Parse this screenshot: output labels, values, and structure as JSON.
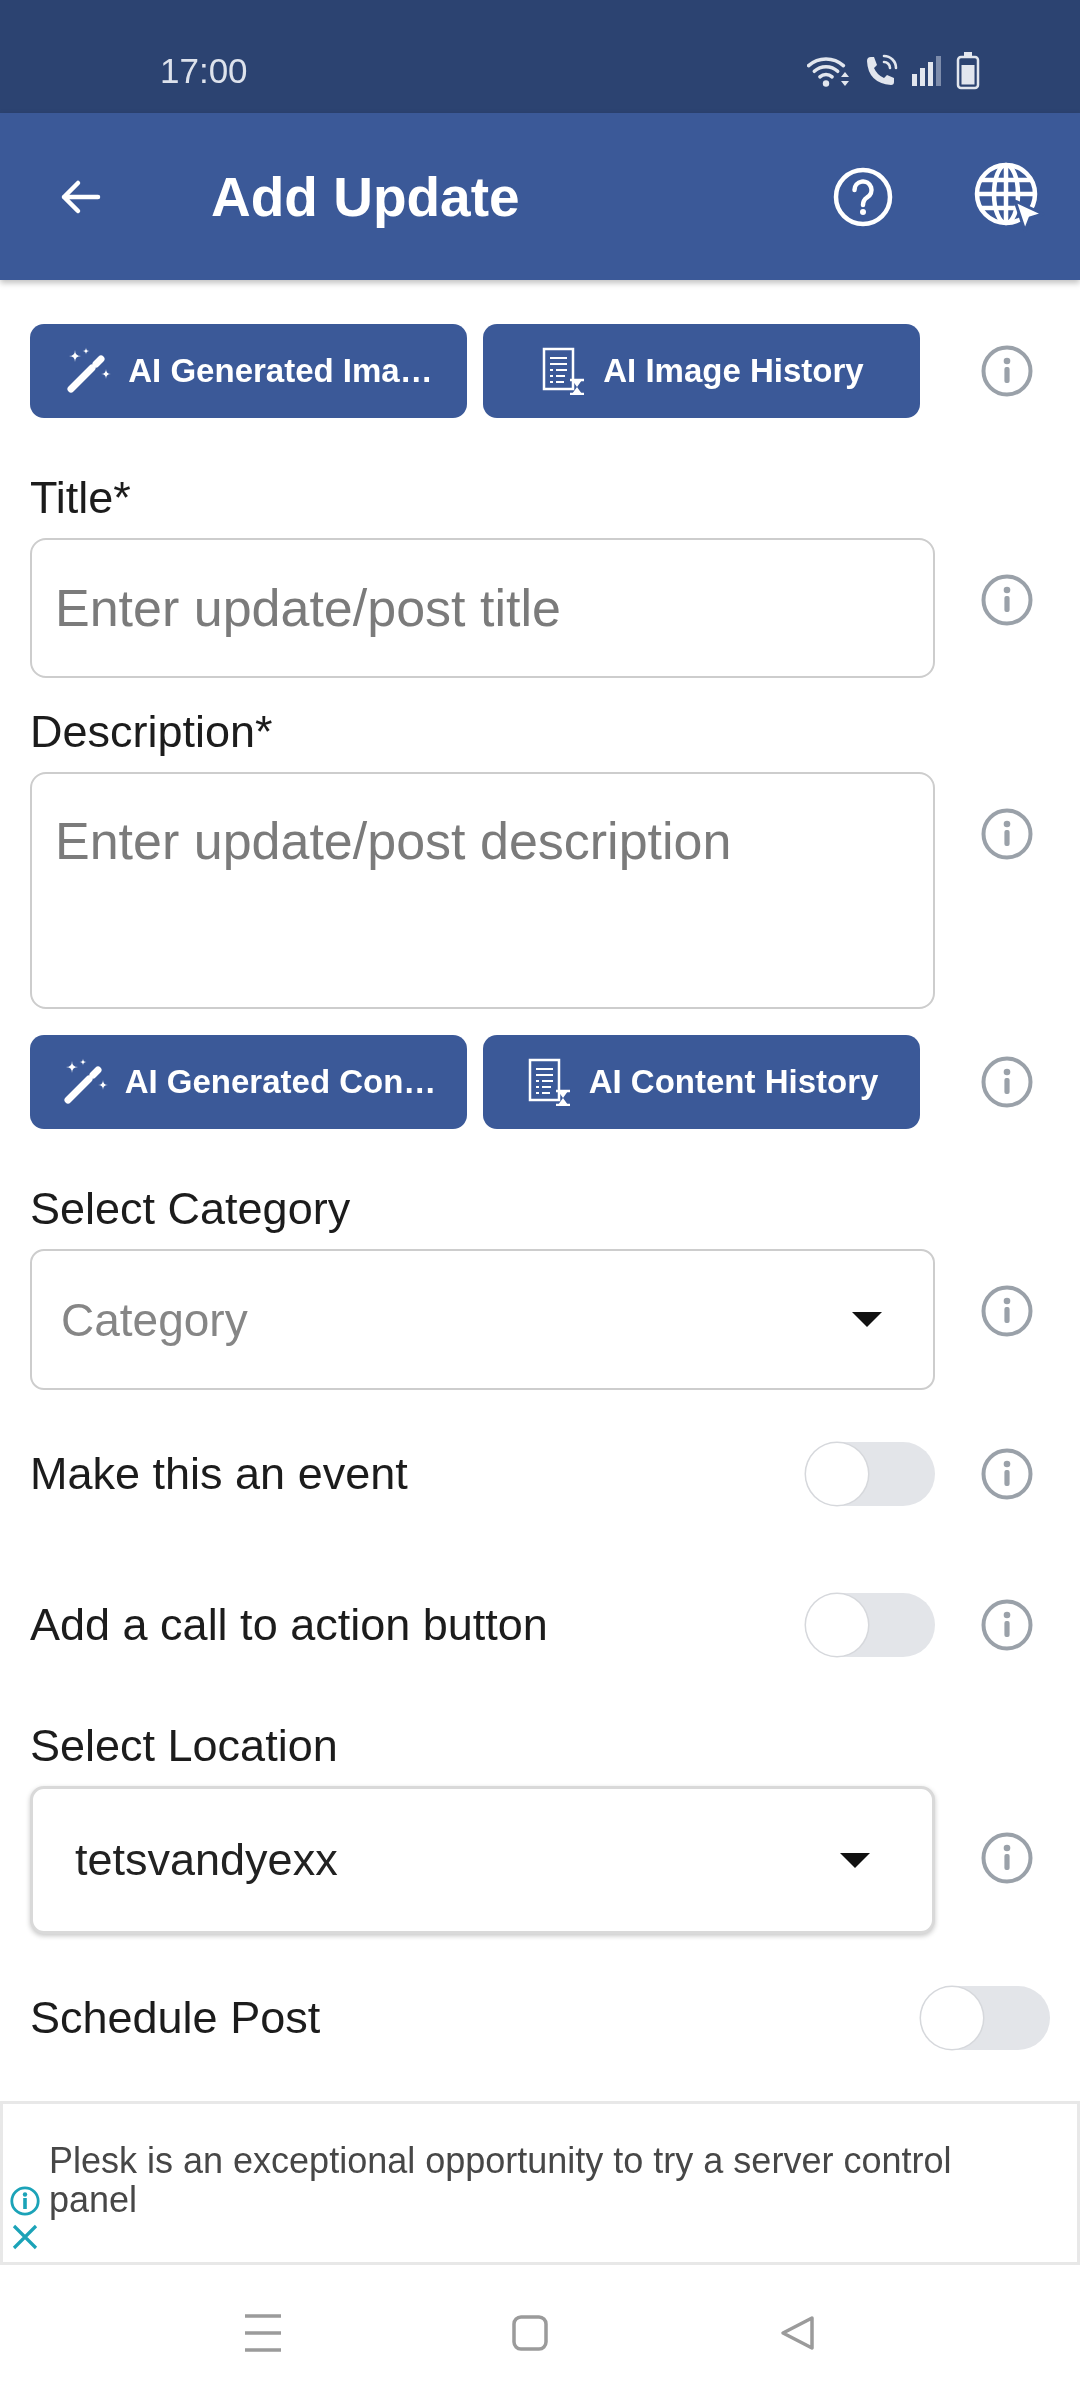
{
  "status_bar": {
    "time": "17:00"
  },
  "app_bar": {
    "title": "Add Update"
  },
  "form": [
    {
      "kind": "button_row",
      "buttons": [
        {
          "kind": "generate",
          "label": "AI Generated Ima…"
        },
        {
          "kind": "history",
          "label": "AI Image History"
        }
      ],
      "info_button": true
    },
    {
      "kind": "text",
      "label": "Title*",
      "placeholder": "Enter update/post title",
      "info_button": true
    },
    {
      "kind": "textarea",
      "label": "Description*",
      "placeholder": "Enter update/post description",
      "info_button": true
    },
    {
      "kind": "button_row",
      "buttons": [
        {
          "kind": "generate",
          "label": "AI Generated Con…"
        },
        {
          "kind": "history",
          "label": "AI Content History"
        }
      ],
      "info_button": true
    },
    {
      "kind": "dropdown",
      "label": "Select Category",
      "placeholder": "Category",
      "info_button": true
    },
    {
      "kind": "toggle",
      "label": "Make this an event",
      "on": false,
      "info_button": true
    },
    {
      "kind": "toggle",
      "label": "Add a call to action button",
      "on": false,
      "info_button": true
    },
    {
      "kind": "dropdown",
      "label": "Select Location",
      "value": "tetsvandyexx",
      "info_button": true
    },
    {
      "kind": "toggle",
      "label": "Schedule Post",
      "on": false,
      "info_button": false
    }
  ],
  "ad_banner": {
    "text": "Plesk is an exceptional opportunity to try a server control panel"
  }
}
